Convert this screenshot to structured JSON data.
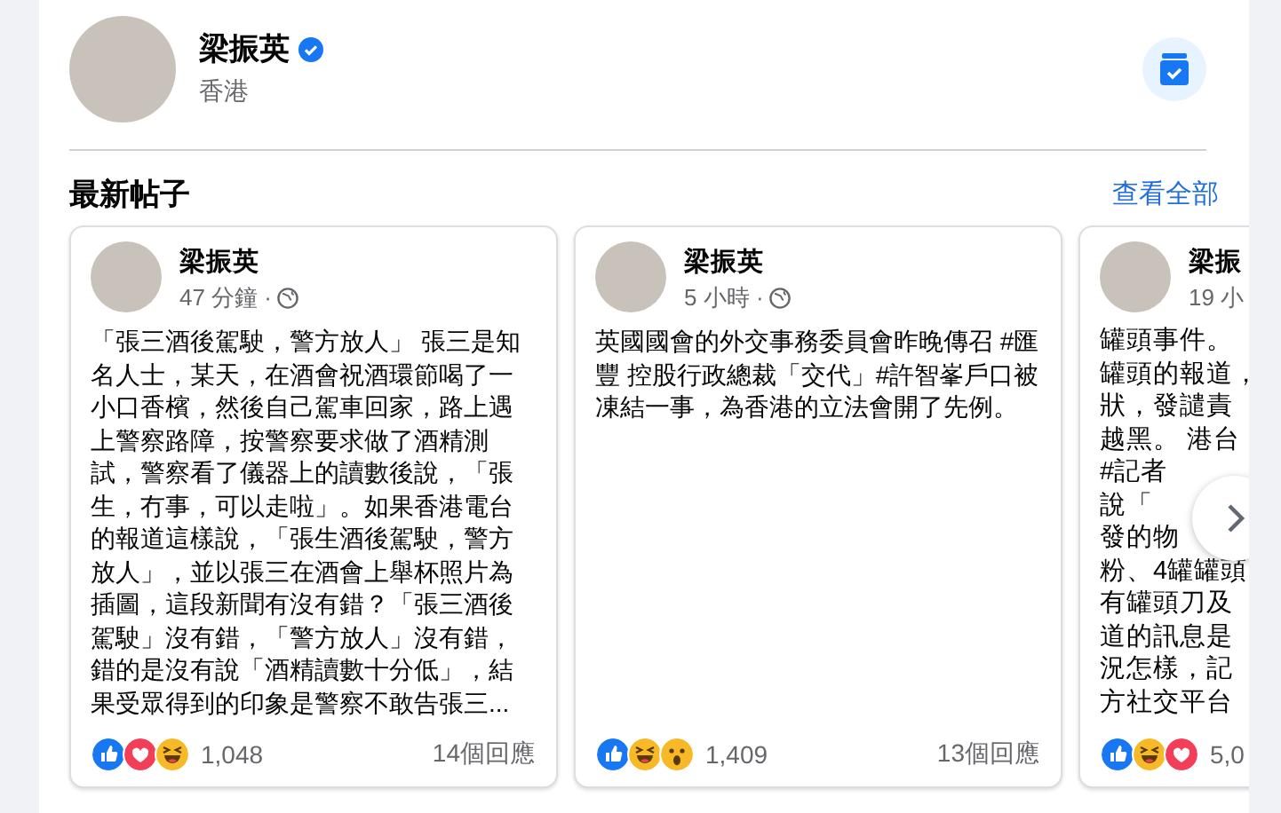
{
  "profile": {
    "name": "梁振英",
    "verified": true,
    "subtitle": "香港"
  },
  "section": {
    "title": "最新帖子",
    "link": "查看全部"
  },
  "posts": [
    {
      "author": "梁振英",
      "time": "47 分鐘 ·",
      "text": "「張三酒後駕駛，警方放人」 張三是知名人士，某天，在酒會祝酒環節喝了一小口香檳，然後自己駕車回家，路上遇上警察路障，按警察要求做了酒精測試，警察看了儀器上的讀數後說，「張生，冇事，可以走啦」。如果香港電台的報道這樣說，「張生酒後駕駛，警方放人」，並以張三在酒會上舉杯照片為插圖，這段新聞有沒有錯？「張三酒後駕駛」沒有錯，「警方放人」沒有錯，錯的是沒有說「酒精讀數十分低」，結果受眾得到的印象是警察不敢告張三...",
      "reactions": [
        {
          "kind": "like"
        },
        {
          "kind": "love"
        },
        {
          "kind": "haha"
        }
      ],
      "count": "1,048",
      "comments": "14個回應"
    },
    {
      "author": "梁振英",
      "time": "5 小時 ·",
      "text": "英國國會的外交事務委員會昨晚傳召 #匯豐 控股行政總裁「交代」#許智峯戶口被凍結一事，為香港的立法會開了先例。",
      "reactions": [
        {
          "kind": "like"
        },
        {
          "kind": "haha"
        },
        {
          "kind": "wow"
        }
      ],
      "count": "1,409",
      "comments": "13個回應"
    },
    {
      "author": "梁振",
      "time": "19 小",
      "lines": [
        "罐頭事件。",
        "罐頭的報道，",
        "狀，發譴責",
        "越黑。 港台",
        "#記者",
        "說「",
        "發的物",
        "粉、4罐罐頭",
        "有罐頭刀及",
        "道的訊息是",
        "況怎樣，記",
        "方社交平台"
      ],
      "reactions": [
        {
          "kind": "like"
        },
        {
          "kind": "haha"
        },
        {
          "kind": "love"
        }
      ],
      "count": "5,0"
    }
  ]
}
